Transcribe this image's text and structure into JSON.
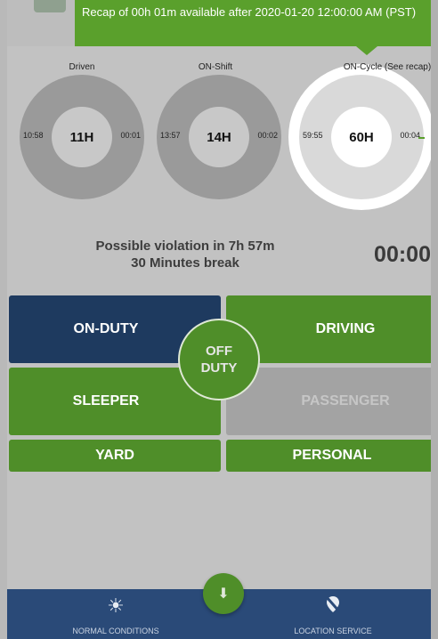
{
  "recap": {
    "message": "Recap of 00h 01m available after 2020-01-20 12:00:00 AM (PST)"
  },
  "gauges": [
    {
      "label": "Driven",
      "center": "11H",
      "left": "10:58",
      "right": "00:01"
    },
    {
      "label": "ON-Shift",
      "center": "14H",
      "left": "13:57",
      "right": "00:02"
    },
    {
      "label": "ON-Cycle (See recap)",
      "center": "60H",
      "left": "59:55",
      "right": "00:04"
    }
  ],
  "violation": {
    "line1": "Possible violation in 7h 57m",
    "line2": "30 Minutes break",
    "timer": "00:00"
  },
  "status": {
    "on_duty": "ON-DUTY",
    "driving": "DRIVING",
    "off_duty_1": "OFF",
    "off_duty_2": "DUTY",
    "sleeper": "SLEEPER",
    "passenger": "PASSENGER",
    "yard": "YARD",
    "personal": "PERSONAL"
  },
  "bottom_nav": {
    "left_label": "NORMAL CONDITIONS",
    "left_icon": "sun-icon",
    "right_label": "LOCATION SERVICE",
    "right_icon": "location-off-icon",
    "fab_icon": "arrow-down-icon"
  },
  "colors": {
    "green": "#4f8e29",
    "navy": "#1e3a5f",
    "nav_bg": "#2a4a78"
  }
}
